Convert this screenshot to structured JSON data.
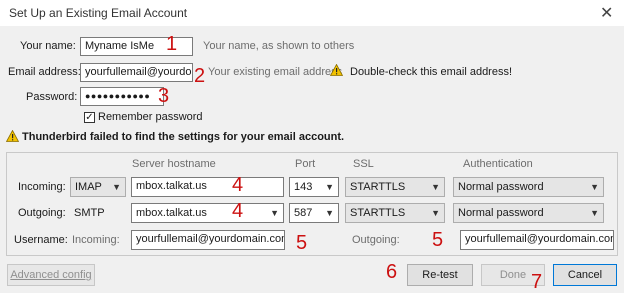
{
  "window": {
    "title": "Set Up an Existing Email Account",
    "close_glyph": "✕"
  },
  "identity": {
    "name_label": "Your name:",
    "name_value": "Myname IsMe",
    "name_hint": "Your name, as shown to others",
    "email_label": "Email address:",
    "email_value": "yourfullemail@yourdomain.com",
    "email_hint": "Your existing email address",
    "email_warning": "Double-check this email address!",
    "password_label": "Password:",
    "password_value": "●●●●●●●●●●●",
    "remember_label": "Remember password",
    "remember_checked": true,
    "check_glyph": "✓"
  },
  "status_message": "Thunderbird failed to find the settings for your email account.",
  "server": {
    "headers": {
      "hostname": "Server hostname",
      "port": "Port",
      "ssl": "SSL",
      "auth": "Authentication"
    },
    "incoming": {
      "label": "Incoming:",
      "protocol": "IMAP",
      "hostname": "mbox.talkat.us",
      "port": "143",
      "ssl": "STARTTLS",
      "auth": "Normal password"
    },
    "outgoing": {
      "label": "Outgoing:",
      "protocol": "SMTP",
      "hostname": "mbox.talkat.us",
      "port": "587",
      "ssl": "STARTTLS",
      "auth": "Normal password"
    },
    "username": {
      "label": "Username:",
      "incoming_label": "Incoming:",
      "incoming_value": "yourfullemail@yourdomain.com",
      "outgoing_label": "Outgoing:",
      "outgoing_value": "yourfullemail@yourdomain.com"
    }
  },
  "buttons": {
    "advanced": "Advanced config",
    "retest": "Re-test",
    "done": "Done",
    "cancel": "Cancel"
  },
  "annotations": {
    "n1": "1",
    "n2": "2",
    "n3": "3",
    "n4a": "4",
    "n4b": "4",
    "n5a": "5",
    "n5b": "5",
    "n6": "6",
    "n7": "7"
  },
  "colors": {
    "annotation": "#cc1111",
    "warning": "#f2c200",
    "focus": "#0078d7"
  },
  "icons": {
    "warning": "warning-icon",
    "close": "close-icon",
    "dropdown": "chevron-down-icon"
  }
}
